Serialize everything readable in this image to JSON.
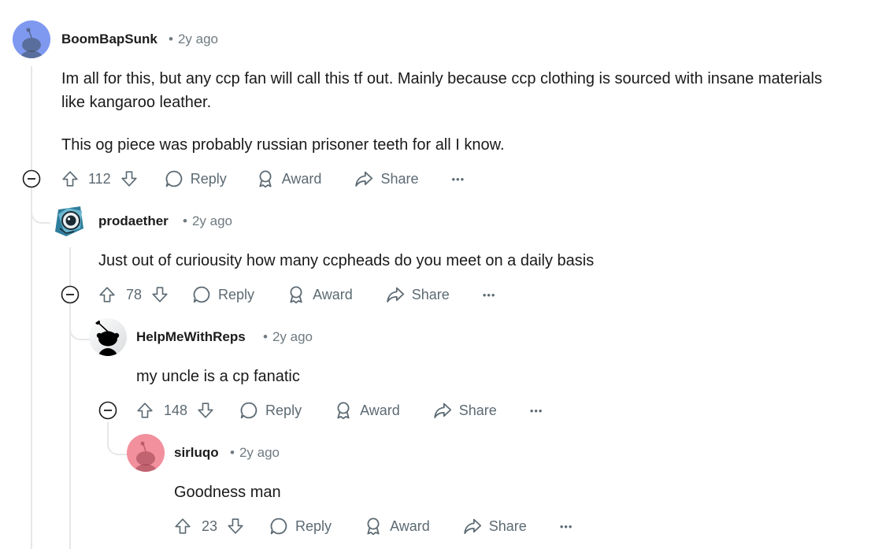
{
  "comments": [
    {
      "username": "BoomBapSunk",
      "time": "2y ago",
      "avatar": "snoo-blue-avatar",
      "body": [
        "Im all for this, but any ccp fan will call this tf out. Mainly because ccp clothing is sourced with insane materials",
        "like kangaroo leather.",
        "This og piece was probably russian prisoner teeth for all I know."
      ],
      "score": "112"
    },
    {
      "username": "prodaether",
      "time": "2y ago",
      "avatar": "astronaut-avatar",
      "body": [
        "Just out of curiousity how many ccpheads do you meet on a daily basis"
      ],
      "score": "78"
    },
    {
      "username": "HelpMeWithReps",
      "time": "2y ago",
      "avatar": "snoo-black-avatar",
      "body": [
        "my uncle is a cp fanatic"
      ],
      "score": "148"
    },
    {
      "username": "sirluqo",
      "time": "2y ago",
      "avatar": "snoo-pink-avatar",
      "body": [
        "Goodness man"
      ],
      "score": "23"
    }
  ],
  "actions": {
    "reply": "Reply",
    "award": "Award",
    "share": "Share",
    "more": "•••"
  },
  "meta_separator": "•",
  "colors": {
    "text": "#1a1a1b",
    "muted": "#6f7a80",
    "thread_line": "#e5e7e9",
    "avatar_blue": "#7f99f0",
    "avatar_pink": "#f2909e"
  }
}
